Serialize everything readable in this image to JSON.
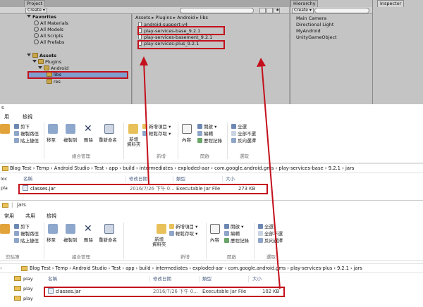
{
  "unity": {
    "project_tab": "Project",
    "create_label": "Create",
    "favorites_label": "Favorites",
    "favorites": [
      "All Materials",
      "All Models",
      "All Scripts",
      "All Prefabs"
    ],
    "assets_label": "Assets",
    "plugins_label": "Plugins",
    "android_label": "Android",
    "libs_label": "libs",
    "res_label": "res",
    "breadcrumb": "Assets ▸ Plugins ▸ Android ▸ libs",
    "files": [
      "android-support-v4",
      "play-services-base_9.2.1",
      "play-services-basement_9.2.1",
      "play-services-plus_9.2.1"
    ],
    "hierarchy_tab": "Hierarchy",
    "hierarchy_create": "Create",
    "hierarchy_items": [
      "Main Camera",
      "Directional Light",
      "MyAndroid",
      "UnityGameObject"
    ],
    "inspector_tab": "Inspector"
  },
  "explorer1": {
    "title_fragment": "s",
    "tabs": [
      "用",
      "檢視"
    ],
    "clipboard": {
      "cut": "剪下",
      "copy_path": "複製路徑",
      "paste_shortcut": "貼上捷徑"
    },
    "organize": {
      "move": "移至",
      "copy": "複製到",
      "delete": "刪除",
      "rename": "重新命名",
      "group": "組合管理"
    },
    "new": {
      "folder": "新增\n資料夾",
      "new_item": "新增項目",
      "easy_access": "輕鬆存取",
      "group": "新增"
    },
    "open": {
      "properties": "內容",
      "open": "開啟",
      "edit": "編輯",
      "history": "歷程記錄",
      "group": "開啟"
    },
    "select": {
      "all": "全選",
      "none": "全部不選",
      "invert": "反向選擇",
      "group": "選取"
    },
    "address": "Blog Test  ›  Temp  ›  Android Studio  ›  Test  ›  app  ›  build  ›  intermediates  ›  exploded-aar  ›  com.google.android.gms  ›  play-services-base  ›  9.2.1  ›  jars",
    "nav_items": [
      "loc",
      "pla"
    ],
    "columns": [
      "名稱",
      "修改日期",
      "類型",
      "大小"
    ],
    "file": {
      "name": "classes.jar",
      "date": "2016/7/26 下午 0...",
      "type": "Executable Jar File",
      "size": "273 KB"
    }
  },
  "explorer2": {
    "window_title": "jars",
    "tabs": [
      "常用",
      "共用",
      "檢視"
    ],
    "clipboard": {
      "cut": "剪下",
      "copy_path": "複製路徑",
      "paste_shortcut": "貼上捷徑",
      "group": "剪貼簿"
    },
    "organize": {
      "move": "移至",
      "copy": "複製到",
      "delete": "刪除",
      "rename": "重新命名",
      "group": "組合管理"
    },
    "new": {
      "folder": "新增\n資料夾",
      "new_item": "新增項目",
      "easy_access": "輕鬆存取",
      "group": "新增"
    },
    "open": {
      "properties": "內容",
      "open": "開啟",
      "edit": "編輯",
      "history": "歷程記錄",
      "group": "開啟"
    },
    "select": {
      "all": "全選",
      "none": "全部不選",
      "invert": "反向選擇",
      "group": "選取"
    },
    "address": "Blog Test  ›  Temp  ›  Android Studio  ›  Test  ›  app  ›  build  ›  intermediates  ›  exploded-aar  ›  com.google.android.gms  ›  play-services-plus  ›  9.2.1  ›  jars",
    "nav_items": [
      "play",
      "play",
      "play"
    ],
    "columns": [
      "名稱",
      "修改日期",
      "類型",
      "大小"
    ],
    "file": {
      "name": "classes.jar",
      "date": "2016/7/26 下午 0...",
      "type": "Executable Jar File",
      "size": "102 KB"
    }
  },
  "colors": {
    "annotation_red": "#c3101c",
    "unity_gray": "#c4c4c4",
    "folder_yellow": "#e8c15a"
  }
}
